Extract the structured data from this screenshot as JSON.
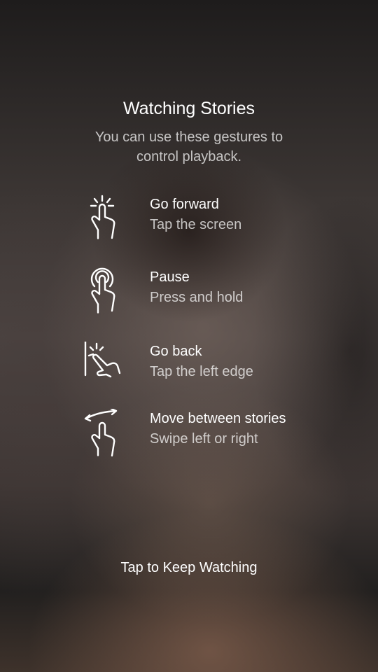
{
  "overlay": {
    "title": "Watching Stories",
    "subtitle": "You can use these gestures to control playback.",
    "gestures": [
      {
        "icon": "tap-gesture-icon",
        "name": "Go forward",
        "description": "Tap the screen"
      },
      {
        "icon": "press-hold-gesture-icon",
        "name": "Pause",
        "description": "Press and hold"
      },
      {
        "icon": "tap-left-edge-gesture-icon",
        "name": "Go back",
        "description": "Tap the left edge"
      },
      {
        "icon": "swipe-gesture-icon",
        "name": "Move between stories",
        "description": "Swipe left or right"
      }
    ],
    "dismiss_label": "Tap to Keep Watching"
  }
}
